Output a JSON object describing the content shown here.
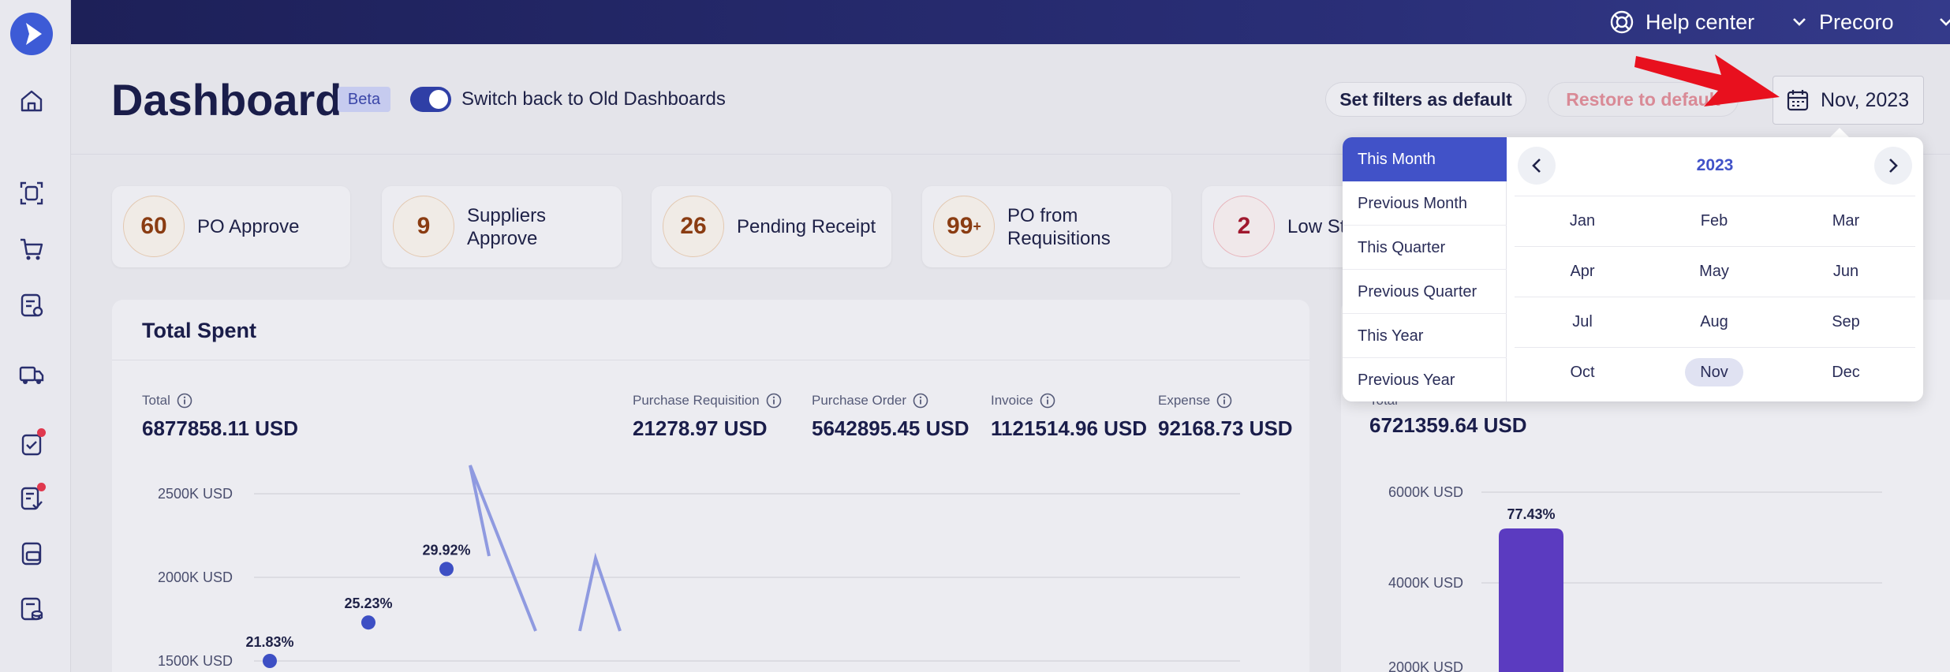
{
  "topbar": {
    "help_label": "Help center",
    "company": "Precoro"
  },
  "header": {
    "title": "Dashboard",
    "badge": "Beta",
    "toggle_label": "Switch back to Old Dashboards",
    "set_default_label": "Set filters as default",
    "restore_label": "Restore to default",
    "date_label": "Nov, 2023"
  },
  "cards": [
    {
      "count": "60",
      "label": "PO Approve"
    },
    {
      "count": "9",
      "label_line1": "Suppliers",
      "label_line2": "Approve"
    },
    {
      "count": "26",
      "label": "Pending Receipt"
    },
    {
      "count": "99",
      "count_suffix": "+",
      "label_line1": "PO from",
      "label_line2": "Requisitions"
    },
    {
      "count": "2",
      "label": "Low St"
    }
  ],
  "total_spent": {
    "title": "Total Spent",
    "total_label": "Total",
    "total_value": "6877858.11 USD",
    "metrics": [
      {
        "label": "Purchase Requisition",
        "value": "21278.97 USD"
      },
      {
        "label": "Purchase Order",
        "value": "5642895.45 USD"
      },
      {
        "label": "Invoice",
        "value": "1121514.96 USD"
      },
      {
        "label": "Expense",
        "value": "92168.73 USD"
      }
    ]
  },
  "chart_data": [
    {
      "type": "line",
      "yticks": [
        "2500K USD",
        "2000K USD",
        "1500K USD"
      ],
      "points": [
        {
          "label": "21.83%",
          "y": 1500
        },
        {
          "label": "25.23%",
          "y": 1730
        },
        {
          "label": "29.92%",
          "y": 2050
        }
      ]
    },
    {
      "type": "bar",
      "yticks": [
        "6000K USD",
        "4000K USD",
        "2000K USD"
      ],
      "bars": [
        {
          "label": "77.43%",
          "value": 5200
        }
      ]
    }
  ],
  "right_panel": {
    "label_partial": "Total",
    "value": "6721359.64 USD"
  },
  "period_picker": {
    "presets": [
      "This Month",
      "Previous Month",
      "This Quarter",
      "Previous Quarter",
      "This Year",
      "Previous Year"
    ],
    "active_preset": "This Month",
    "year": "2023",
    "months": [
      "Jan",
      "Feb",
      "Mar",
      "Apr",
      "May",
      "Jun",
      "Jul",
      "Aug",
      "Sep",
      "Oct",
      "Nov",
      "Dec"
    ],
    "selected_month": "Nov"
  },
  "colors": {
    "accent": "#4152c8",
    "topbar": "#1d2058",
    "line": "#3d4fc4",
    "bar": "#5b3bc0",
    "annotation_arrow": "#e8101e"
  }
}
